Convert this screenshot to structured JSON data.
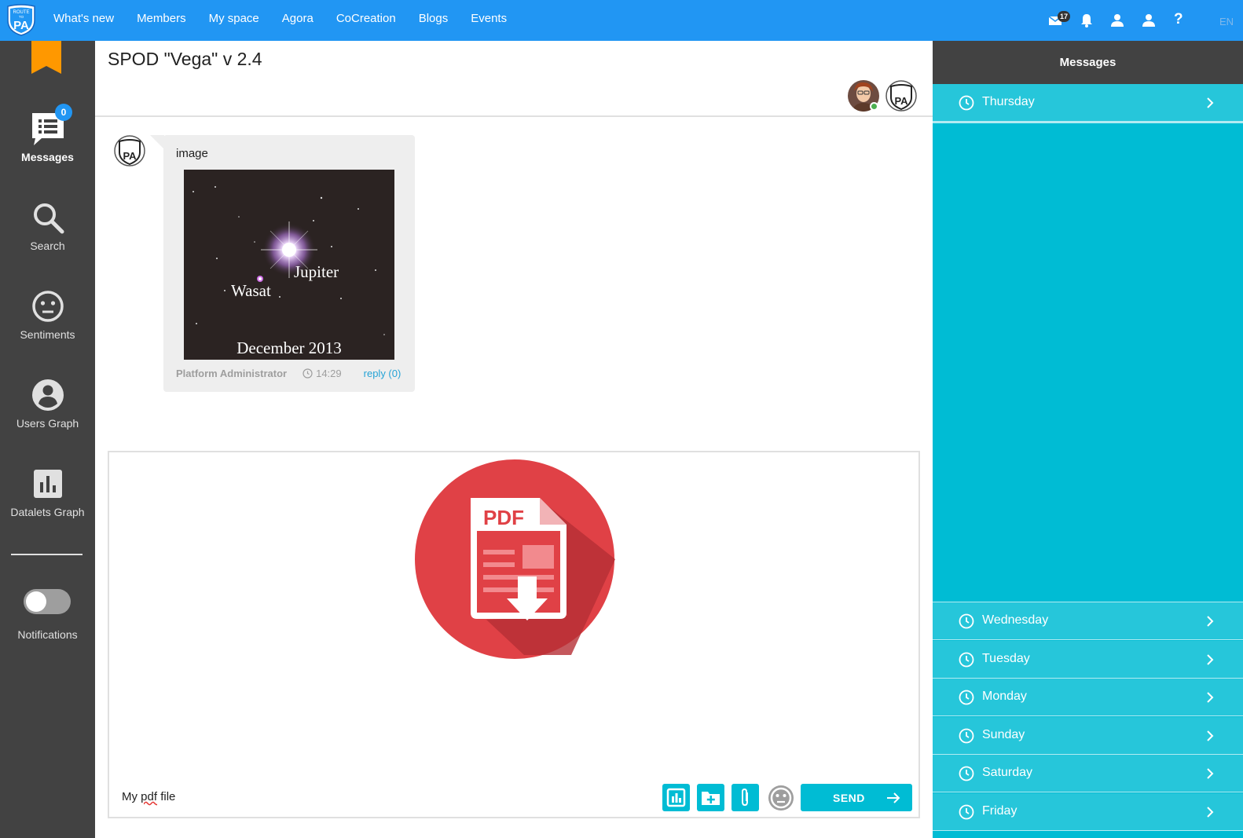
{
  "topbar": {
    "logo": {
      "line1": "ROUTE",
      "line2": "TO",
      "line3": "PA"
    },
    "nav": [
      "What's new",
      "Members",
      "My space",
      "Agora",
      "CoCreation",
      "Blogs",
      "Events"
    ],
    "mail_count": "17",
    "help_label": "?",
    "language": "EN",
    "icons": [
      "mail-icon",
      "bell-icon",
      "user-icon",
      "user-icon",
      "help-icon"
    ]
  },
  "sidebar": {
    "messages_label": "Messages",
    "messages_count": "0",
    "search_label": "Search",
    "sentiments_label": "Sentiments",
    "users_graph_label": "Users Graph",
    "datalets_graph_label": "Datalets Graph",
    "notifications_label": "Notifications",
    "notifications_enabled": false
  },
  "room": {
    "title": "SPOD \"Vega\" v 2.4"
  },
  "message": {
    "text": "image",
    "author": "Platform Administrator",
    "time": "14:29",
    "reply_label": "reply (0)",
    "image_labels": {
      "star1": "Jupiter",
      "star2": "Wasat",
      "caption": "December 2013"
    }
  },
  "composer": {
    "attachment_label": "PDF",
    "text_before": "My ",
    "text_underlined": "pdf",
    "text_after": " file",
    "send_label": "SEND"
  },
  "rpanel": {
    "title": "Messages",
    "days": [
      "Thursday",
      "Wednesday",
      "Tuesday",
      "Monday",
      "Sunday",
      "Saturday",
      "Friday"
    ]
  },
  "colors": {
    "topbar": "#2196f3",
    "sidebar": "#424242",
    "accent": "#00bcd4",
    "pdf_red": "#e04146",
    "bookmark": "#ff9800"
  }
}
